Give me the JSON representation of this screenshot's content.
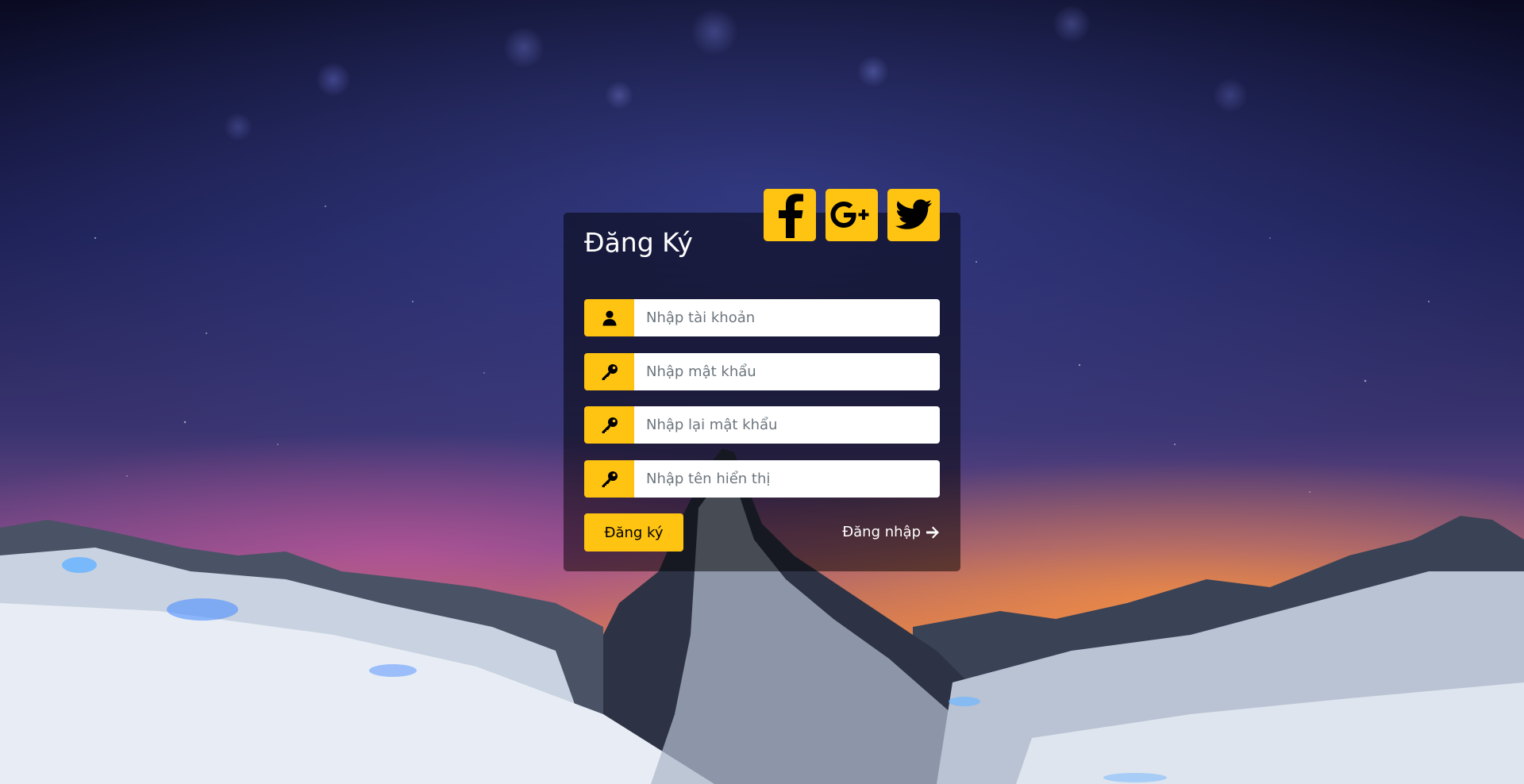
{
  "card": {
    "title": "Đăng Ký"
  },
  "social": {
    "facebook": "facebook-icon",
    "google_plus": "google-plus-icon",
    "twitter": "twitter-icon"
  },
  "form": {
    "username": {
      "placeholder": "Nhập tài khoản",
      "value": "",
      "icon": "user-icon"
    },
    "password": {
      "placeholder": "Nhập mật khẩu",
      "value": "",
      "icon": "key-icon"
    },
    "confirm_password": {
      "placeholder": "Nhập lại mật khẩu",
      "value": "",
      "icon": "key-icon"
    },
    "display_name": {
      "placeholder": "Nhập tên hiển thị",
      "value": "",
      "icon": "key-icon"
    }
  },
  "actions": {
    "submit_label": "Đăng ký",
    "login_label": "Đăng nhập",
    "login_icon": "arrow-right-icon"
  },
  "colors": {
    "accent": "#FFC312",
    "card_bg": "rgba(0,0,0,0.5)"
  }
}
